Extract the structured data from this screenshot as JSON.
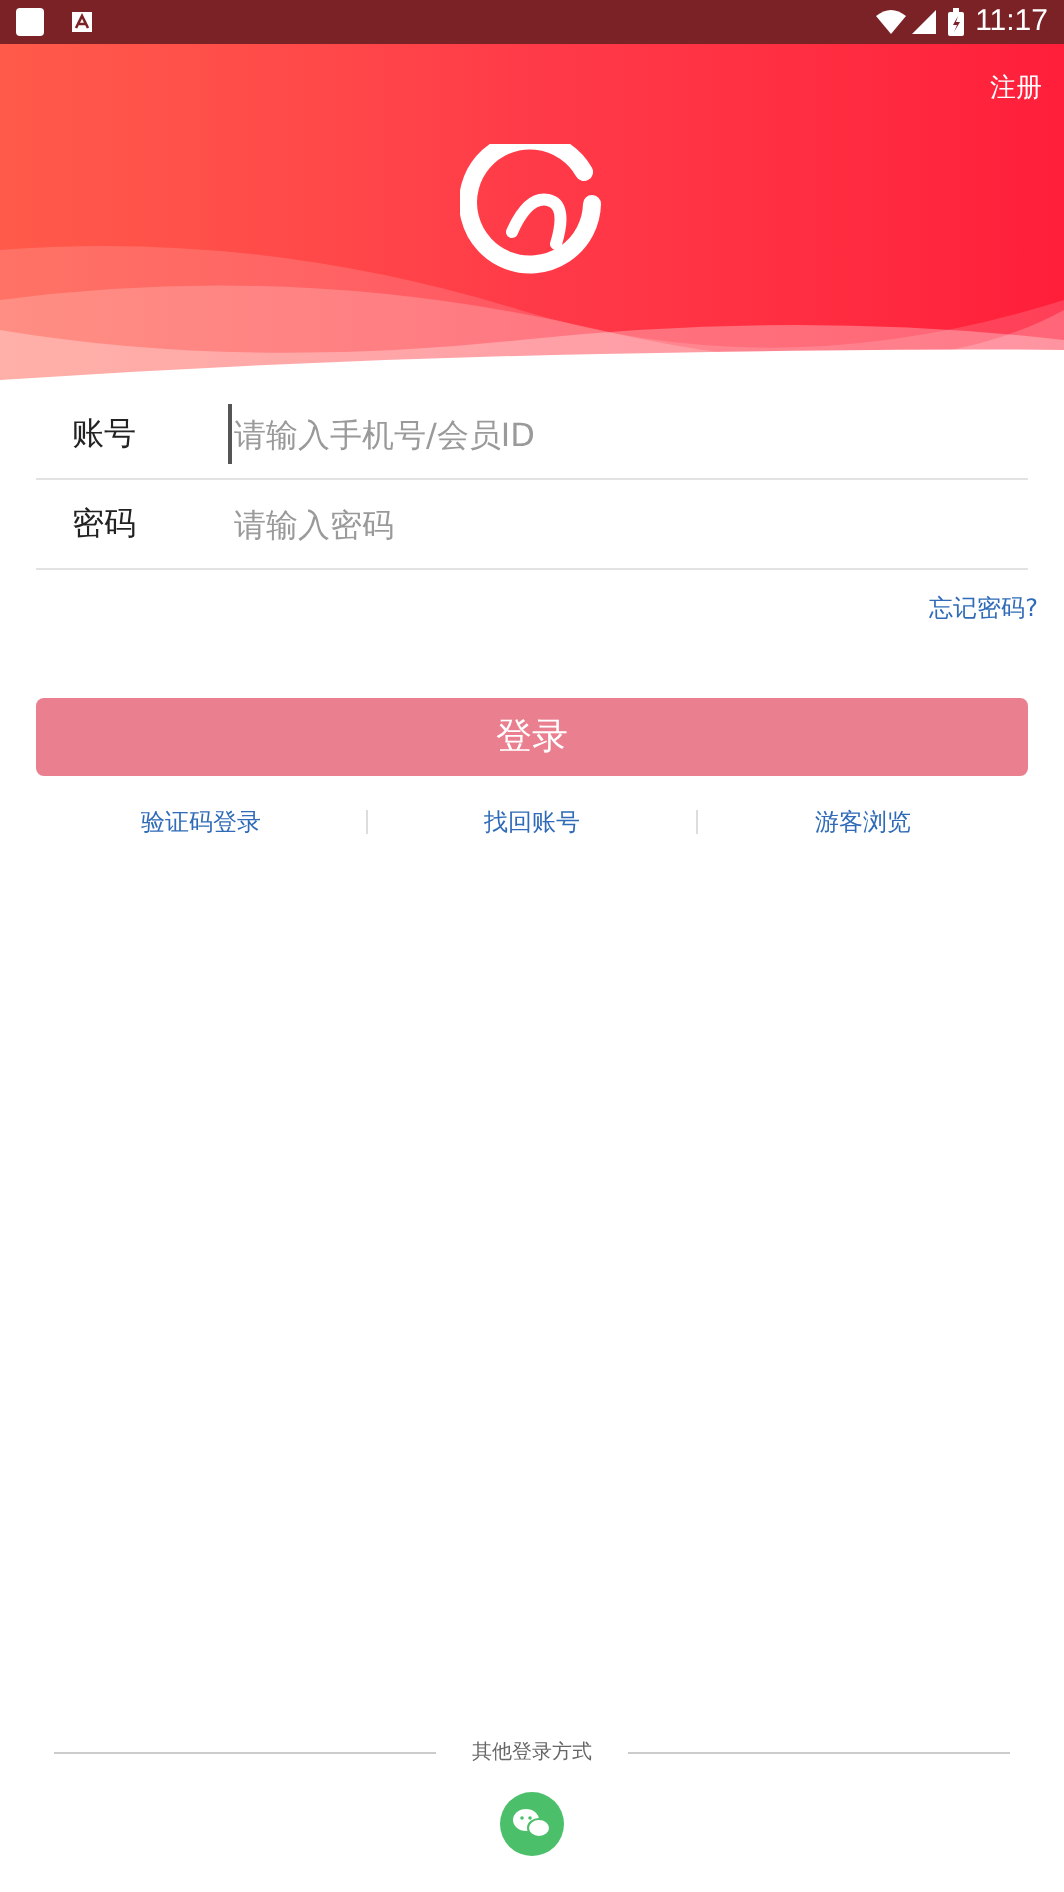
{
  "status_bar": {
    "time": "11:17"
  },
  "header": {
    "register_link": "注册"
  },
  "fields": [
    {
      "label": "账号",
      "placeholder": "请输入手机号/会员ID",
      "focused": true
    },
    {
      "label": "密码",
      "placeholder": "请输入密码",
      "focused": false
    }
  ],
  "forgot_link": "忘记密码?",
  "login_button": {
    "label": "登录",
    "disabled": true
  },
  "links": [
    "验证码登录",
    "找回账号",
    "游客浏览"
  ],
  "other_login": {
    "title": "其他登录方式"
  }
}
